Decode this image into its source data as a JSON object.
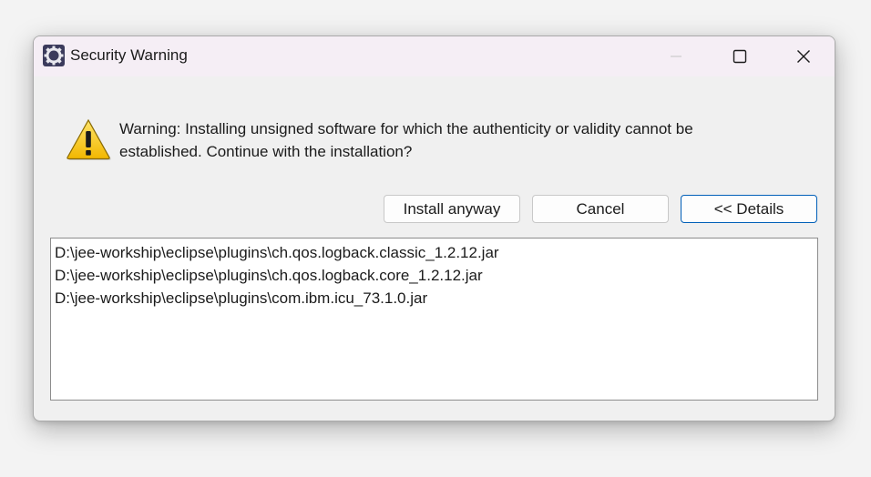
{
  "window": {
    "title": "Security Warning"
  },
  "icons": {
    "app": "eclipse-gear-icon",
    "warning": "warning-triangle-icon",
    "minimize": "minimize-icon",
    "maximize": "maximize-icon",
    "close": "close-icon"
  },
  "message": {
    "text": "Warning: Installing unsigned software for which the authenticity or validity cannot be established. Continue with the installation?"
  },
  "buttons": {
    "install_label": "Install anyway",
    "cancel_label": "Cancel",
    "details_label": "<< Details"
  },
  "details": {
    "items": [
      "D:\\jee-workship\\eclipse\\plugins\\ch.qos.logback.classic_1.2.12.jar",
      "D:\\jee-workship\\eclipse\\plugins\\ch.qos.logback.core_1.2.12.jar",
      "D:\\jee-workship\\eclipse\\plugins\\com.ibm.icu_73.1.0.jar"
    ]
  },
  "colors": {
    "titlebar": "#f5eef5",
    "accent": "#005fb8",
    "warning_yellow": "#f7c600"
  }
}
